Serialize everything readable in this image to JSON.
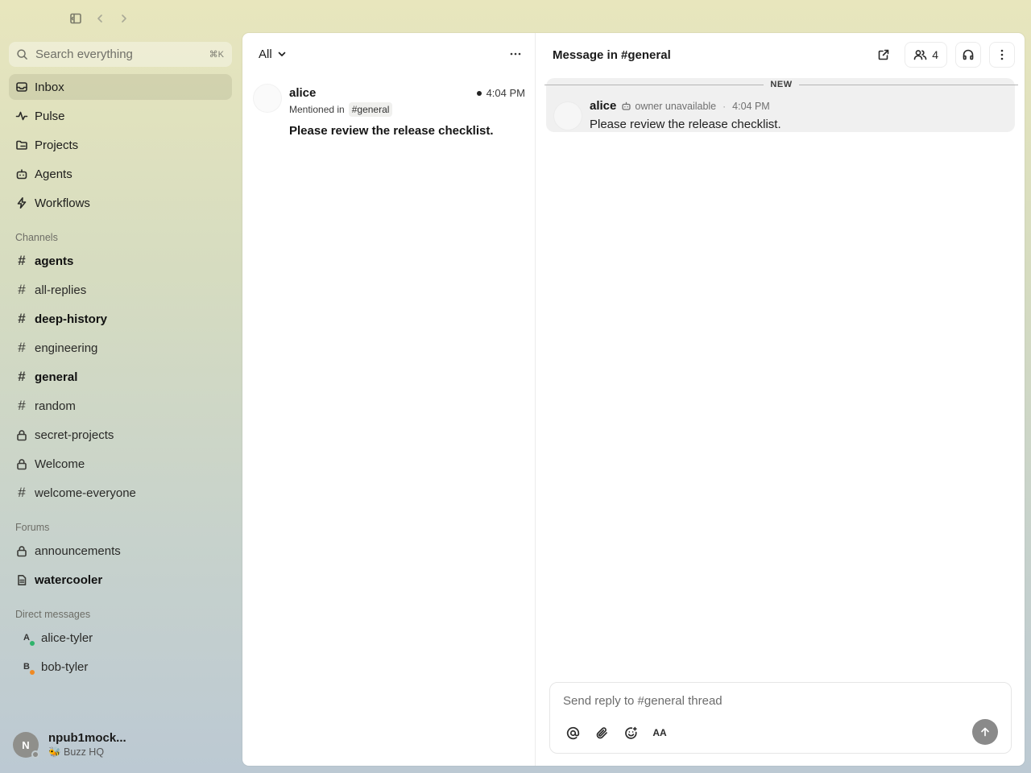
{
  "window": {
    "controls": [
      "sidebar-toggle-icon",
      "back-icon",
      "forward-icon"
    ]
  },
  "sidebar": {
    "search": {
      "placeholder": "Search everything",
      "shortcut": "⌘K"
    },
    "nav": [
      {
        "label": "Inbox",
        "icon": "inbox-icon",
        "active": true
      },
      {
        "label": "Pulse",
        "icon": "pulse-icon"
      },
      {
        "label": "Projects",
        "icon": "projects-icon"
      },
      {
        "label": "Agents",
        "icon": "bot-icon"
      },
      {
        "label": "Workflows",
        "icon": "bolt-icon"
      }
    ],
    "channels_title": "Channels",
    "channels": [
      {
        "label": "agents",
        "type": "hash",
        "unread": true
      },
      {
        "label": "all-replies",
        "type": "hash",
        "unread": false
      },
      {
        "label": "deep-history",
        "type": "hash",
        "unread": true
      },
      {
        "label": "engineering",
        "type": "hash",
        "unread": false
      },
      {
        "label": "general",
        "type": "hash",
        "unread": true
      },
      {
        "label": "random",
        "type": "hash",
        "unread": false
      },
      {
        "label": "secret-projects",
        "type": "lock",
        "unread": false
      },
      {
        "label": "Welcome",
        "type": "lock",
        "unread": false
      },
      {
        "label": "welcome-everyone",
        "type": "hash",
        "unread": false
      }
    ],
    "forums_title": "Forums",
    "forums": [
      {
        "label": "announcements",
        "type": "lock",
        "unread": false
      },
      {
        "label": "watercooler",
        "type": "doc",
        "unread": true
      }
    ],
    "dms_title": "Direct messages",
    "dms": [
      {
        "label": "alice-tyler",
        "initial": "A",
        "status_color": "#2fb36b"
      },
      {
        "label": "bob-tyler",
        "initial": "B",
        "status_color": "#f08a24"
      }
    ],
    "user": {
      "initial": "N",
      "name": "npub1mock...",
      "workspace": "🐝 Buzz HQ"
    }
  },
  "inbox": {
    "filter": "All",
    "items": [
      {
        "author": "alice",
        "time": "4:04 PM",
        "context_prefix": "Mentioned in",
        "channel": "#general",
        "body": "Please review the release checklist."
      }
    ]
  },
  "thread": {
    "title": "Message in #general",
    "member_count": "4",
    "divider_label": "NEW",
    "message": {
      "author": "alice",
      "status": "owner unavailable",
      "separator": "·",
      "time": "4:04 PM",
      "text": "Please review the release checklist."
    },
    "composer": {
      "placeholder": "Send reply to #general thread",
      "format_label": "AA"
    }
  }
}
